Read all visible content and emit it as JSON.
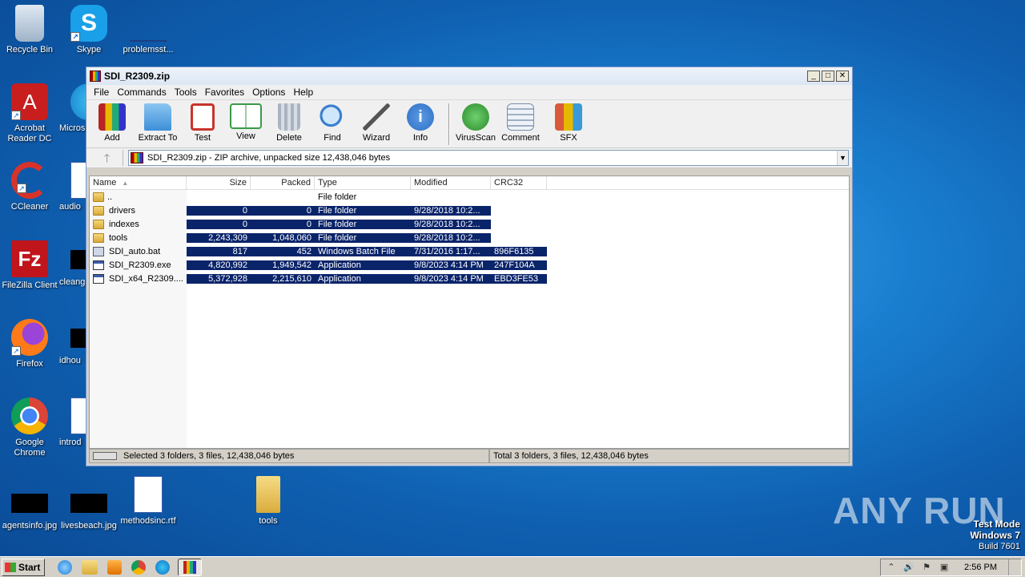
{
  "desktop": {
    "icons": [
      {
        "label": "Recycle Bin"
      },
      {
        "label": "Skype"
      },
      {
        "label": "problemsst..."
      },
      {
        "label": "Acrobat Reader DC"
      },
      {
        "label": "Micros"
      },
      {
        "label": "CCleaner"
      },
      {
        "label": "audio"
      },
      {
        "label": "FileZilla Client"
      },
      {
        "label": "cleang"
      },
      {
        "label": "Firefox"
      },
      {
        "label": "idhou"
      },
      {
        "label": "Google Chrome"
      },
      {
        "label": "introd"
      },
      {
        "label": "agentsinfo.jpg"
      },
      {
        "label": "livesbeach.jpg"
      },
      {
        "label": "methodsinc.rtf"
      },
      {
        "label": "tools"
      }
    ]
  },
  "window": {
    "title": "SDI_R2309.zip",
    "controls": {
      "minimize": "_",
      "maximize": "□",
      "close": "✕"
    },
    "menu": [
      "File",
      "Commands",
      "Tools",
      "Favorites",
      "Options",
      "Help"
    ],
    "toolbar": [
      {
        "label": "Add",
        "icon": "add-icon",
        "color": "#c43c2c"
      },
      {
        "label": "Extract To",
        "icon": "extract-icon",
        "color": "#3d8fd8"
      },
      {
        "label": "Test",
        "icon": "test-icon",
        "color": "#c8342b"
      },
      {
        "label": "View",
        "icon": "view-icon",
        "color": "#3a9a48"
      },
      {
        "label": "Delete",
        "icon": "delete-icon",
        "color": "#8a96a4"
      },
      {
        "label": "Find",
        "icon": "find-icon",
        "color": "#3b7fd0"
      },
      {
        "label": "Wizard",
        "icon": "wizard-icon",
        "color": "#8a8a8a"
      },
      {
        "label": "Info",
        "icon": "info-icon",
        "color": "#2f6fc8"
      },
      {
        "label": "VirusScan",
        "icon": "virusscan-icon",
        "color": "#3aa03a"
      },
      {
        "label": "Comment",
        "icon": "comment-icon",
        "color": "#7a8fa8"
      },
      {
        "label": "SFX",
        "icon": "sfx-icon",
        "color": "#d85a3a"
      }
    ],
    "address": "SDI_R2309.zip - ZIP archive, unpacked size 12,438,046 bytes",
    "columns": [
      "Name",
      "Size",
      "Packed",
      "Type",
      "Modified",
      "CRC32"
    ],
    "rows": [
      {
        "name": "..",
        "size": "",
        "packed": "",
        "type": "File folder",
        "modified": "",
        "crc": "",
        "icon": "folder",
        "selected": false
      },
      {
        "name": "drivers",
        "size": "0",
        "packed": "0",
        "type": "File folder",
        "modified": "9/28/2018 10:2...",
        "crc": "",
        "icon": "folder",
        "selected": true
      },
      {
        "name": "indexes",
        "size": "0",
        "packed": "0",
        "type": "File folder",
        "modified": "9/28/2018 10:2...",
        "crc": "",
        "icon": "folder",
        "selected": true
      },
      {
        "name": "tools",
        "size": "2,243,309",
        "packed": "1,048,060",
        "type": "File folder",
        "modified": "9/28/2018 10:2...",
        "crc": "",
        "icon": "folder",
        "selected": true
      },
      {
        "name": "SDI_auto.bat",
        "size": "817",
        "packed": "452",
        "type": "Windows Batch File",
        "modified": "7/31/2016 1:17...",
        "crc": "896F6135",
        "icon": "bat",
        "selected": true
      },
      {
        "name": "SDI_R2309.exe",
        "size": "4,820,992",
        "packed": "1,949,542",
        "type": "Application",
        "modified": "9/8/2023 4:14 PM",
        "crc": "247F104A",
        "icon": "exe",
        "selected": true
      },
      {
        "name": "SDI_x64_R2309....",
        "size": "5,372,928",
        "packed": "2,215,610",
        "type": "Application",
        "modified": "9/8/2023 4:14 PM",
        "crc": "EBD3FE53",
        "icon": "exe",
        "selected": true
      }
    ],
    "status_left": "Selected 3 folders, 3 files, 12,438,046 bytes",
    "status_right": "Total 3 folders, 3 files, 12,438,046 bytes"
  },
  "taskbar": {
    "start_label": "Start",
    "clock": "2:56 PM"
  },
  "watermark": "ANY RUN",
  "test_mode": {
    "line1": "Test Mode",
    "line2": "Windows 7",
    "line3": "Build 7601"
  }
}
